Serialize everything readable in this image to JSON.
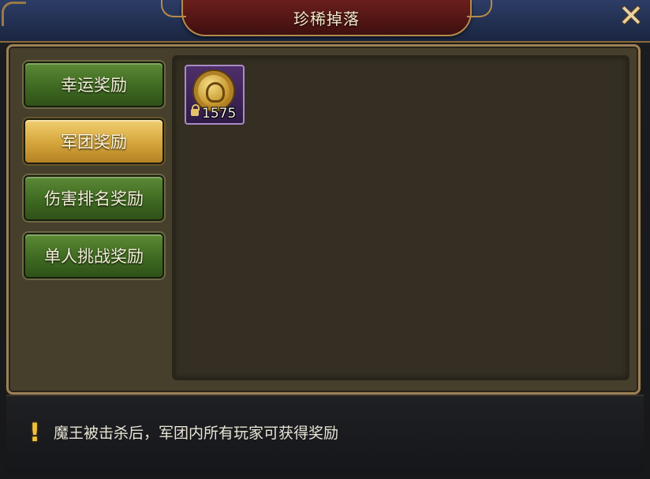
{
  "window": {
    "title": "珍稀掉落",
    "close_icon": "close-x-icon",
    "accent_color": "#b58a4b"
  },
  "tabs": [
    {
      "label": "幸运奖励",
      "selected": false,
      "color": "#3f6a22"
    },
    {
      "label": "军团奖励",
      "selected": true,
      "color": "#d7a93f"
    },
    {
      "label": "伤害排名奖励",
      "selected": false,
      "color": "#3f6a22"
    },
    {
      "label": "单人挑战奖励",
      "selected": false,
      "color": "#3f6a22"
    }
  ],
  "items": [
    {
      "icon": "gold-coin-icon",
      "locked": true,
      "count": "1575"
    }
  ],
  "footer": {
    "icon": "exclamation-icon",
    "notice": "魔王被击杀后，军团内所有玩家可获得奖励"
  }
}
